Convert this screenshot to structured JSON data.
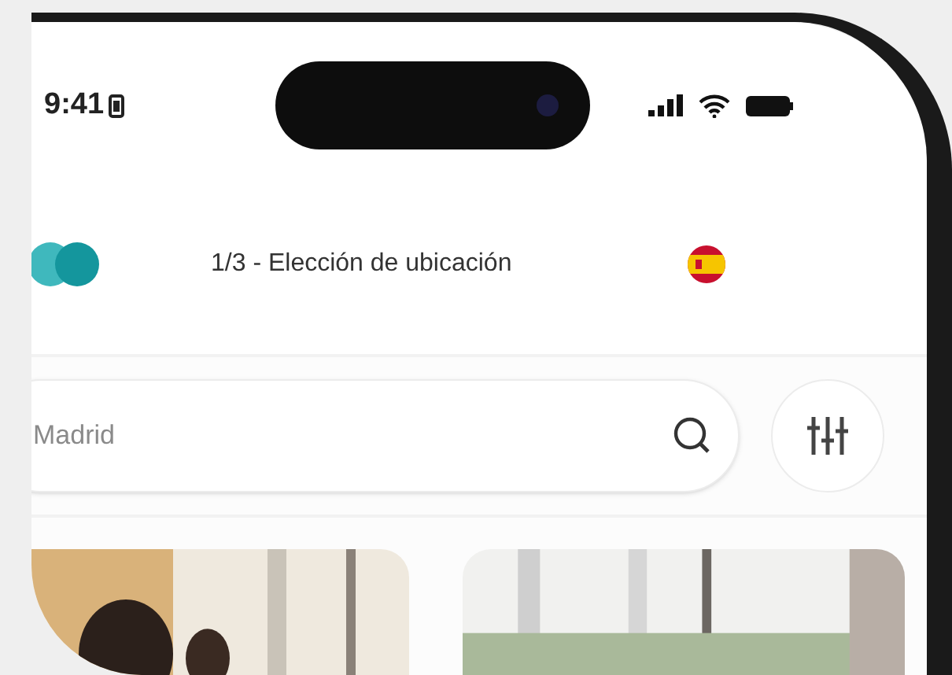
{
  "status_bar": {
    "time": "9:41"
  },
  "header": {
    "title": "1/3 - Elección de ubicación"
  },
  "search": {
    "placeholder": "Madrid"
  }
}
